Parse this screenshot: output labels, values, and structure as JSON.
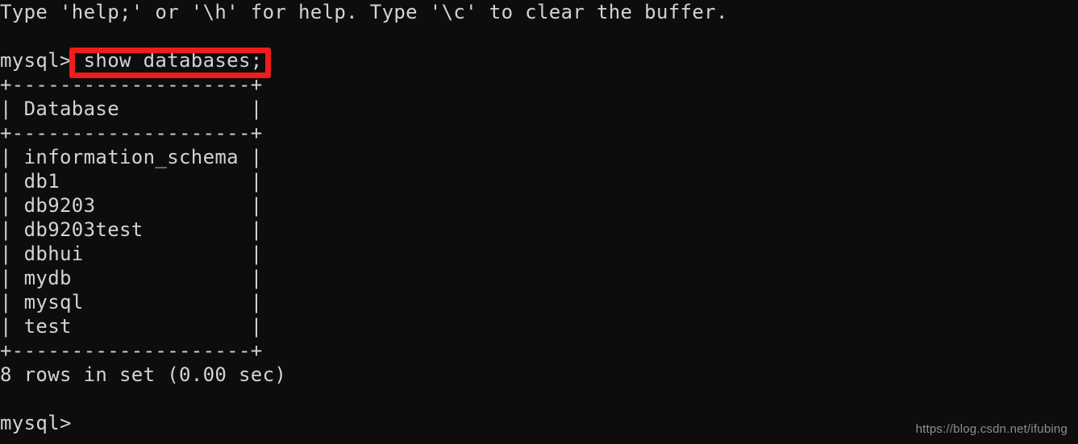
{
  "terminal": {
    "background_color": "#0d0d0d",
    "text_color": "#d3d3d3",
    "prompt": "mysql>",
    "help_line": "Type 'help;' or '\\h' for help. Type '\\c' to clear the buffer.",
    "blank": "",
    "command_prompt_line": "mysql> show databases;",
    "command": "show databases;",
    "table": {
      "top_border": "+--------------------+",
      "header_row": "| Database           |",
      "header_separator": "+--------------------+",
      "column_header": "Database",
      "rows": [
        "| information_schema |",
        "| db1                |",
        "| db9203             |",
        "| db9203test         |",
        "| dbhui              |",
        "| mydb               |",
        "| mysql              |",
        "| test               |"
      ],
      "values": [
        "information_schema",
        "db1",
        "db9203",
        "db9203test",
        "dbhui",
        "mydb",
        "mysql",
        "test"
      ],
      "bottom_border": "+--------------------+"
    },
    "result_status": "8 rows in set (0.00 sec)",
    "row_count": 8,
    "elapsed": "0.00 sec",
    "final_prompt": "mysql>"
  },
  "annotation": {
    "highlight_color": "#f01c1c",
    "highlighted_text": "show databases;"
  },
  "watermark": {
    "text": "https://blog.csdn.net/ifubing",
    "color": "#8e8e8e"
  }
}
